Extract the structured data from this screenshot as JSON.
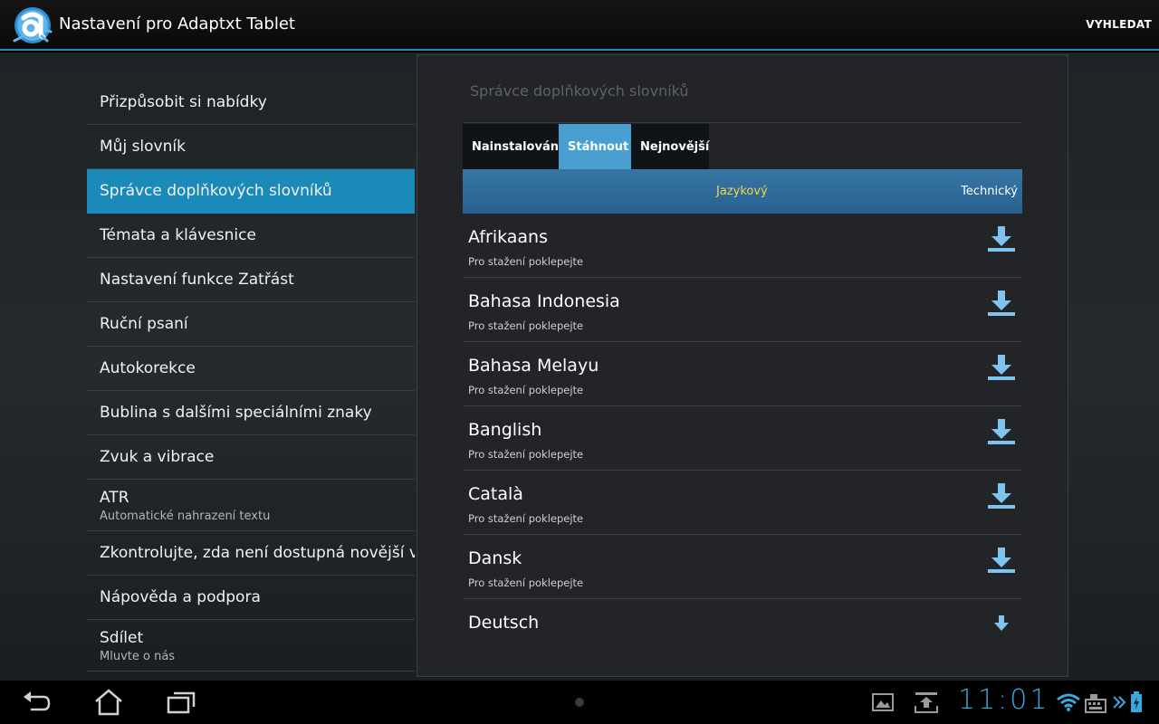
{
  "actionbar": {
    "title": "Nastavení pro Adaptxt Tablet",
    "search_label": "VYHLEDAT",
    "accent_color": "#2f86b6"
  },
  "headers": [
    {
      "title": "Přizpůsobit si nabídky"
    },
    {
      "title": "Můj slovník"
    },
    {
      "title": "Správce doplňkových slovníků",
      "selected": true
    },
    {
      "title": "Témata a klávesnice"
    },
    {
      "title": "Nastavení funkce Zatřást"
    },
    {
      "title": "Ruční psaní"
    },
    {
      "title": "Autokorekce"
    },
    {
      "title": "Bublina s dalšími speciálními znaky"
    },
    {
      "title": "Zvuk a vibrace"
    },
    {
      "title": "ATR",
      "summary": "Automatické nahrazení textu"
    },
    {
      "title": "Zkontrolujte, zda není dostupná novější verze"
    },
    {
      "title": "Nápověda a podpora"
    },
    {
      "title": "Sdílet",
      "summary": "Mluvte o nás"
    }
  ],
  "panel": {
    "title": "Správce doplňkových slovníků",
    "tabs": [
      {
        "label": "Nainstalován",
        "active": false
      },
      {
        "label": "Stáhnout",
        "active": true
      },
      {
        "label": "Nejnovější",
        "active": false
      }
    ],
    "subtabs": {
      "language_label": "Jazykový",
      "technical_label": "Technický"
    },
    "dictionaries": [
      {
        "name": "Afrikaans",
        "hint": "Pro stažení poklepejte"
      },
      {
        "name": "Bahasa Indonesia",
        "hint": "Pro stažení poklepejte"
      },
      {
        "name": "Bahasa Melayu",
        "hint": "Pro stažení poklepejte"
      },
      {
        "name": "Banglish",
        "hint": "Pro stažení poklepejte"
      },
      {
        "name": "Català",
        "hint": "Pro stažení poklepejte"
      },
      {
        "name": "Dansk",
        "hint": "Pro stažení poklepejte"
      },
      {
        "name": "Deutsch",
        "hint": ""
      }
    ]
  },
  "statusbar": {
    "time": "11:01",
    "icons": [
      "gallery-icon",
      "download-notification-icon",
      "wifi-icon",
      "keyboard-icon",
      "chevron-icon",
      "battery-icon"
    ]
  },
  "navbar": {
    "icons": [
      "back-icon",
      "home-icon",
      "recent-apps-icon"
    ]
  }
}
